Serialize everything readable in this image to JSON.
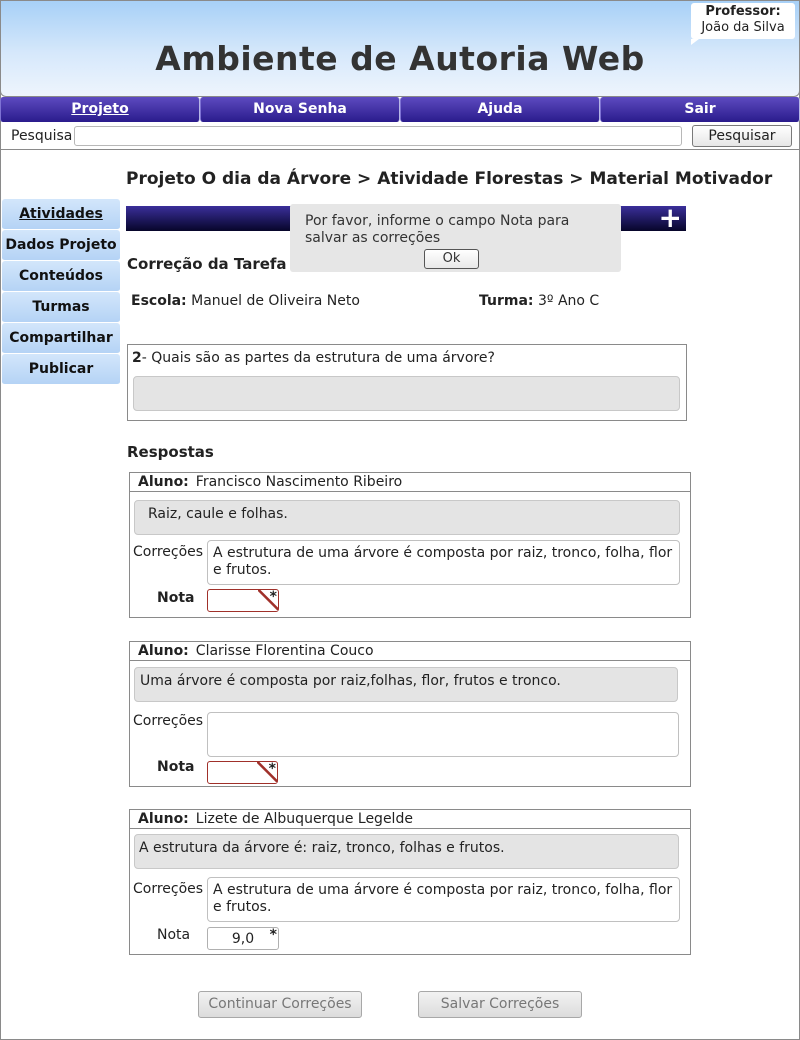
{
  "header": {
    "title": "Ambiente de Autoria Web",
    "professor_label": "Professor:",
    "professor_name": "João da Silva"
  },
  "nav": {
    "items": [
      {
        "label": "Projeto"
      },
      {
        "label": "Nova Senha"
      },
      {
        "label": "Ajuda"
      },
      {
        "label": "Sair"
      }
    ]
  },
  "search": {
    "label": "Pesquisa",
    "value": "",
    "button": "Pesquisar"
  },
  "breadcrumb": "Projeto O dia da Árvore > Atividade Florestas > Material Motivador",
  "sidebar": {
    "items": [
      {
        "label": "Atividades"
      },
      {
        "label": "Dados Projeto"
      },
      {
        "label": "Conteúdos"
      },
      {
        "label": "Turmas"
      },
      {
        "label": "Compartilhar"
      },
      {
        "label": "Publicar"
      }
    ]
  },
  "toolbar": {
    "expand_glyph": "+"
  },
  "dialog": {
    "message": "Por favor, informe o campo Nota para salvar as correções",
    "ok_label": "Ok"
  },
  "main": {
    "section_title": "Correção da Tarefa",
    "escola_label": "Escola:",
    "escola_value": "Manuel de Oliveira Neto",
    "turma_label": "Turma:",
    "turma_value": "3º Ano C",
    "question_number": "2",
    "question_text": "- Quais são as partes  da estrutura de uma árvore?",
    "respostas_title": "Respostas"
  },
  "answers": [
    {
      "aluno_label": "Aluno:",
      "aluno": "Francisco Nascimento Ribeiro",
      "resposta": "Raiz, caule e folhas.",
      "correcoes_label": "Correções",
      "correcao": "A estrutura de uma árvore é composta por raiz, tronco, folha, flor e frutos.",
      "nota_label": "Nota",
      "nota": "",
      "required_mark": "*"
    },
    {
      "aluno_label": "Aluno:",
      "aluno": "Clarisse  Florentina Couco",
      "resposta": "Uma árvore é composta por raiz,folhas, flor, frutos e tronco.",
      "correcoes_label": "Correções",
      "correcao": "",
      "nota_label": "Nota",
      "nota": "",
      "required_mark": "*"
    },
    {
      "aluno_label": "Aluno:",
      "aluno": "Lizete de Albuquerque Legelde",
      "resposta": "A estrutura da árvore é: raiz, tronco, folhas e frutos.",
      "correcoes_label": "Correções",
      "correcao": "A estrutura de uma árvore é composta por raiz, tronco, folha, flor e frutos.",
      "nota_label": "Nota",
      "nota": "9,0",
      "required_mark": "*"
    }
  ],
  "footer": {
    "continue_label": "Continuar Correções",
    "save_label": "Salvar Correções"
  }
}
